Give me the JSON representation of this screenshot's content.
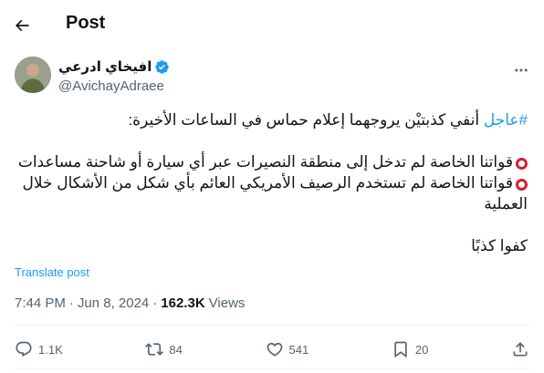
{
  "header": {
    "title": "Post"
  },
  "author": {
    "display_name": "افيخاي ادرعي",
    "handle": "@AvichayAdraee"
  },
  "tweet": {
    "hashtag": "#عاجل",
    "line1_rest": " أنفي كذبتيْن يروجهما إعلام حماس في الساعات الأخيرة:",
    "line2": "قواتنا الخاصة لم تدخل إلى منطقة النصيرات عبر أي سيارة أو شاحنة مساعدات",
    "line3": "قواتنا الخاصة لم تستخدم الرصيف الأمريكي العائم بأي شكل من الأشكال خلال العملية",
    "line4": "كفوا كذبًا"
  },
  "translate_label": "Translate post",
  "meta": {
    "time": "7:44 PM",
    "sep1": "·",
    "date": "Jun 8, 2024",
    "sep2": "·",
    "views_count": "162.3K",
    "views_label": "Views"
  },
  "actions": {
    "replies": "1.1K",
    "reposts": "84",
    "likes": "541",
    "bookmarks": "20"
  },
  "icons": {
    "back": "arrow-left-icon",
    "verified": "verified-badge-icon",
    "more": "more-horizontal-icon",
    "reply": "reply-icon",
    "repost": "repost-icon",
    "like": "heart-icon",
    "bookmark": "bookmark-icon",
    "share": "share-icon"
  },
  "colors": {
    "link": "#1d9bf0",
    "muted": "#536471",
    "emoji_red": "#d3202f"
  }
}
